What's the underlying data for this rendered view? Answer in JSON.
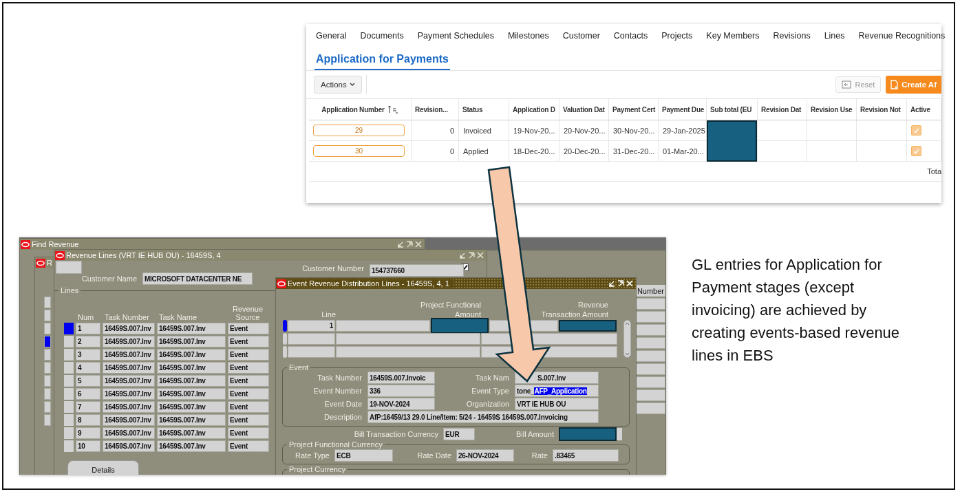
{
  "top_screen": {
    "tabs": [
      {
        "label": "General",
        "selected": false
      },
      {
        "label": "Documents",
        "selected": false
      },
      {
        "label": "Payment Schedules",
        "selected": false
      },
      {
        "label": "Milestones",
        "selected": false
      },
      {
        "label": "Customer",
        "selected": false
      },
      {
        "label": "Contacts",
        "selected": false
      },
      {
        "label": "Projects",
        "selected": false
      },
      {
        "label": "Key Members",
        "selected": false
      },
      {
        "label": "Revisions",
        "selected": false
      },
      {
        "label": "Lines",
        "selected": false
      },
      {
        "label": "Revenue Recognitions",
        "selected": false
      },
      {
        "label": "Application for Payments",
        "selected": true
      }
    ],
    "actions_button": "Actions",
    "reset_button": {
      "label": "Reset",
      "disabled": true
    },
    "create_button": "Create Af",
    "table": {
      "columns": [
        "Application Number",
        "Revision...",
        "Status",
        "Application D",
        "Valuation Dat",
        "Payment Cert",
        "Payment Due",
        "Sub total (EU",
        "Revision Dat",
        "Revision Use",
        "Revision Not",
        "Active"
      ],
      "rows": [
        {
          "application_number": "29",
          "revision": "0",
          "status": "Invoiced",
          "application_date": "19-Nov-20...",
          "valuation_date": "20-Nov-20...",
          "payment_cert": "30-Nov-20...",
          "payment_due": "29-Jan-2025",
          "subtotal_redacted": true,
          "active": true
        },
        {
          "application_number": "30",
          "revision": "0",
          "status": "Applied",
          "application_date": "18-Dec-20...",
          "valuation_date": "20-Dec-20...",
          "payment_cert": "31-Dec-20...",
          "payment_due": "01-Mar-20...",
          "subtotal_redacted": true,
          "active": true
        }
      ],
      "footer": "Tota"
    }
  },
  "oracle_screen": {
    "background_window": {
      "column_header": "Number"
    },
    "find_revenue_window": {
      "title": "Find Revenue"
    },
    "revenue_window": {
      "title": "R",
      "records": [
        {
          "selected": false
        },
        {
          "selected": false
        },
        {
          "selected": false
        },
        {
          "selected": true
        },
        {
          "selected": false
        },
        {
          "selected": false
        },
        {
          "selected": false
        },
        {
          "selected": false
        },
        {
          "selected": false
        },
        {
          "selected": false
        }
      ]
    },
    "revenue_lines_window": {
      "title": "Revenue Lines (VRT IE HUB OU) - 16459S, 4",
      "checkbox": {
        "checked": true
      },
      "customer_name": {
        "label": "Customer Name",
        "value": "MICROSOFT DATACENTER NE"
      },
      "customer_number": {
        "label": "Customer Number",
        "value": "154737660"
      },
      "lines": {
        "title": "Lines",
        "columns": [
          "Num",
          "Task  Number",
          "Task  Name",
          "Revenue Source"
        ],
        "rows": [
          {
            "num": "1",
            "task_number": "16459S.007.Inv",
            "task_name": "16459S.007.Inv",
            "source": "Event",
            "selected": true
          },
          {
            "num": "2",
            "task_number": "16459S.007.Inv",
            "task_name": "16459S.007.Inv",
            "source": "Event",
            "selected": false
          },
          {
            "num": "3",
            "task_number": "16459S.007.Inv",
            "task_name": "16459S.007.Inv",
            "source": "Event",
            "selected": false
          },
          {
            "num": "4",
            "task_number": "16459S.007.Inv",
            "task_name": "16459S.007.Inv",
            "source": "Event",
            "selected": false
          },
          {
            "num": "5",
            "task_number": "16459S.007.Inv",
            "task_name": "16459S.007.Inv",
            "source": "Event",
            "selected": false
          },
          {
            "num": "6",
            "task_number": "16459S.007.Inv",
            "task_name": "16459S.007.Inv",
            "source": "Event",
            "selected": false
          },
          {
            "num": "7",
            "task_number": "16459S.007.Inv",
            "task_name": "16459S.007.Inv",
            "source": "Event",
            "selected": false
          },
          {
            "num": "8",
            "task_number": "16459S.007.Inv",
            "task_name": "16459S.007.Inv",
            "source": "Event",
            "selected": false
          },
          {
            "num": "9",
            "task_number": "16459S.007.Inv",
            "task_name": "16459S.007.Inv",
            "source": "Event",
            "selected": false
          },
          {
            "num": "10",
            "task_number": "16459S.007.Inv",
            "task_name": "16459S.007.Inv",
            "source": "Event",
            "selected": false
          }
        ]
      },
      "details_button": "Details"
    },
    "distribution_window": {
      "title": "Event Revenue Distribution Lines - 16459S, 4, 1",
      "columns": [
        "Line",
        "Project Functional Amount",
        "Revenue Transaction Amount"
      ],
      "rows": [
        {
          "line": "1",
          "selected": true,
          "redacted": true
        },
        {
          "selected": false,
          "redacted": false
        },
        {
          "selected": false,
          "redacted": false
        }
      ],
      "event": {
        "title": "Event",
        "fields": [
          {
            "label": "Task Number",
            "value": "16459S.007.Invoic"
          },
          {
            "label": "Task Nam",
            "value": "S.007.Inv"
          },
          {
            "label": "Event Number",
            "value": "336"
          },
          {
            "label": "Event Type",
            "value": "tone_",
            "selected_text": "AFP_Application"
          },
          {
            "label": "Event Date",
            "value": "19-NOV-2024"
          },
          {
            "label": "Organization",
            "value": "VRT IE HUB OU"
          }
        ],
        "description": {
          "label": "Description",
          "value": "AfP:16459/13 29.0 Line/Item: 5/24 - 16459S 16459S.007.Invoicing"
        }
      },
      "bill_currency": {
        "label": "Bill Transaction Currency",
        "value": "EUR"
      },
      "bill_amount": {
        "label": "Bill Amount",
        "redacted": true
      },
      "project_functional_currency": {
        "title": "Project Functional Currency",
        "fields": [
          {
            "label": "Rate Type",
            "value": "ECB"
          },
          {
            "label": "Rate Date",
            "value": "26-NOV-2024"
          },
          {
            "label": "Rate",
            "value": ".83465"
          }
        ]
      },
      "project_currency": {
        "title": "Project Currency"
      }
    }
  },
  "note": "GL entries for Application for Payment stages (except invoicing) are achieved by creating events-based revenue lines in EBS"
}
